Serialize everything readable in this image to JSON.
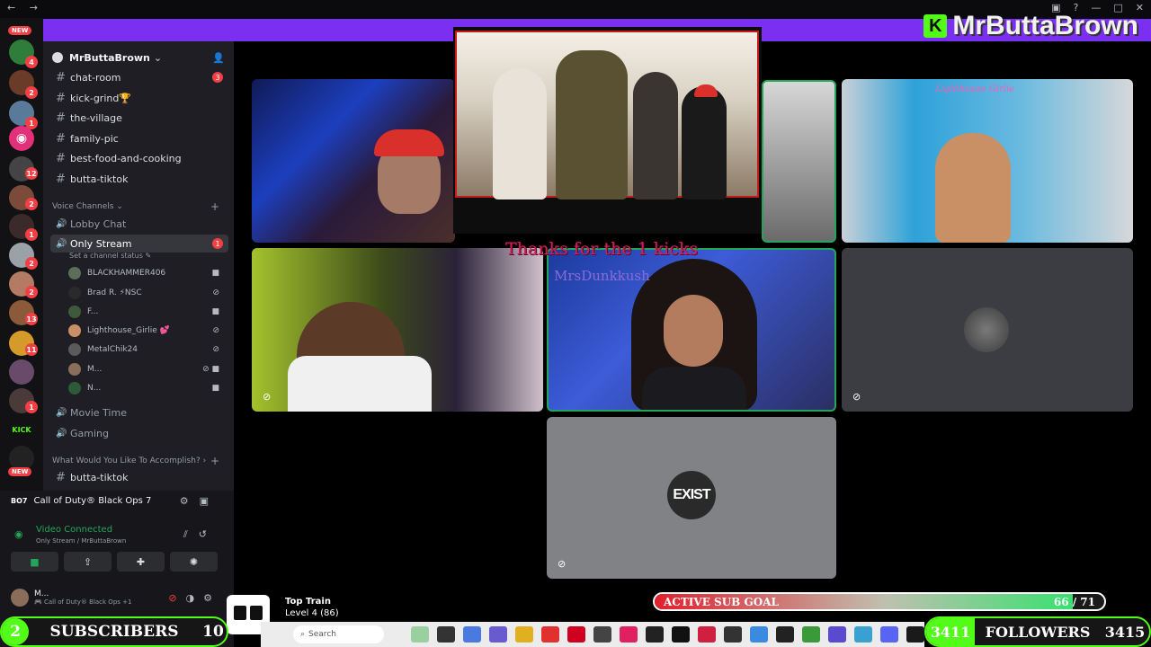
{
  "brand": {
    "name": "MrButtaBrown",
    "k": "K",
    "k_color": "#53fc18"
  },
  "server": {
    "name": "MrButtaBrown"
  },
  "text_channels": [
    {
      "name": "chat-room",
      "count": "3"
    },
    {
      "name": "kick-grind🏆"
    },
    {
      "name": "the-village"
    },
    {
      "name": "family-pic"
    },
    {
      "name": "best-food-and-cooking"
    },
    {
      "name": "butta-tiktok"
    }
  ],
  "voice_category": "Voice Channels",
  "voice_channels": {
    "lobby": "Lobby Chat",
    "stream": "Only Stream",
    "stream_count": "1",
    "stream_status": "Set a channel status",
    "movie": "Movie Time",
    "gaming": "Gaming"
  },
  "members": [
    {
      "name": "BLACKHAMMER406",
      "icon": "camera-icon"
    },
    {
      "name": "Brad R. ⚡NSC",
      "icon": "mic-muted-icon"
    },
    {
      "name": "F...",
      "icon": "camera-icon"
    },
    {
      "name": "Lighthouse_Girlie 💕",
      "icon": "mic-muted-icon"
    },
    {
      "name": "MetalChik24",
      "icon": "mic-muted-icon"
    },
    {
      "name": "M...",
      "icon": "camera-icon"
    },
    {
      "name": "N...",
      "icon": "camera-icon"
    }
  ],
  "category2": "What Would You Like To Accomplish?",
  "category2_channel": "butta-tiktok",
  "activity": {
    "tag": "BO7",
    "game": "Call of Duty® Black Ops 7"
  },
  "voice_status": {
    "title": "Video Connected",
    "sub": "Only Stream / MrButtaBrown"
  },
  "user": {
    "name": "M...",
    "status": "🎮 Call of Duty® Black Ops +1"
  },
  "rail_badges": [
    "4",
    "2",
    "1",
    "12",
    "2",
    "1",
    "2",
    "2",
    "13",
    "11",
    "1"
  ],
  "new_label": "NEW",
  "tiles": {
    "lighthouse_label": "Lighthouse Girlie",
    "watermark": "MrsDunkkush",
    "exist": "EXIST"
  },
  "kicks_text": "Thanks for the 1 kicks",
  "subscribers": {
    "count": "2",
    "label": "SUBSCRIBERS",
    "goal": "10"
  },
  "top_train": {
    "title": "Top Train",
    "level": "Level 4 (86)"
  },
  "taskbar": {
    "search": "Search"
  },
  "sub_goal": {
    "label": "ACTIVE SUB GOAL",
    "value": "66 / 71",
    "progress": 0.93
  },
  "followers": {
    "current": "3411",
    "label": "FOLLOWERS",
    "goal": "3415"
  }
}
